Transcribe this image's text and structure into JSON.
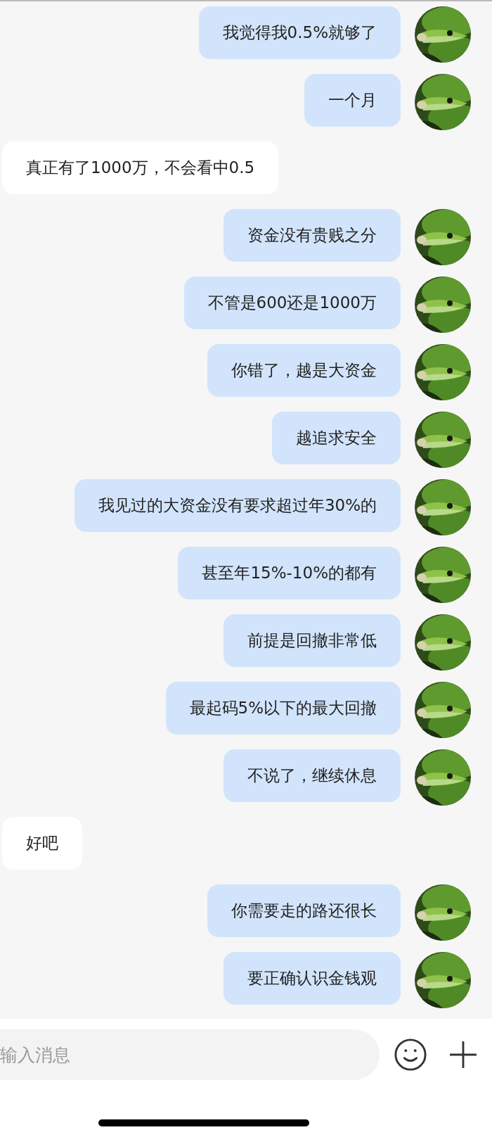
{
  "messages": [
    {
      "kind": "sent",
      "text": "我觉得我0.5%就够了"
    },
    {
      "kind": "sent",
      "text": "一个月"
    },
    {
      "kind": "received",
      "text": "真正有了1000万，不会看中0.5"
    },
    {
      "kind": "sent",
      "text": "资金没有贵贱之分"
    },
    {
      "kind": "sent",
      "text": "不管是600还是1000万"
    },
    {
      "kind": "sent",
      "text": "你错了，越是大资金"
    },
    {
      "kind": "sent",
      "text": "越追求安全"
    },
    {
      "kind": "sent",
      "text": "我见过的大资金没有要求超过年30%的"
    },
    {
      "kind": "sent",
      "text": "甚至年15%-10%的都有"
    },
    {
      "kind": "sent",
      "text": "前提是回撤非常低"
    },
    {
      "kind": "sent",
      "text": "最起码5%以下的最大回撤"
    },
    {
      "kind": "sent",
      "text": "不说了，继续休息"
    },
    {
      "kind": "received",
      "text": "好吧"
    },
    {
      "kind": "sent",
      "text": "你需要走的路还很长"
    },
    {
      "kind": "sent",
      "text": "要正确认识金钱观"
    }
  ],
  "composer": {
    "placeholder": "输入消息"
  }
}
